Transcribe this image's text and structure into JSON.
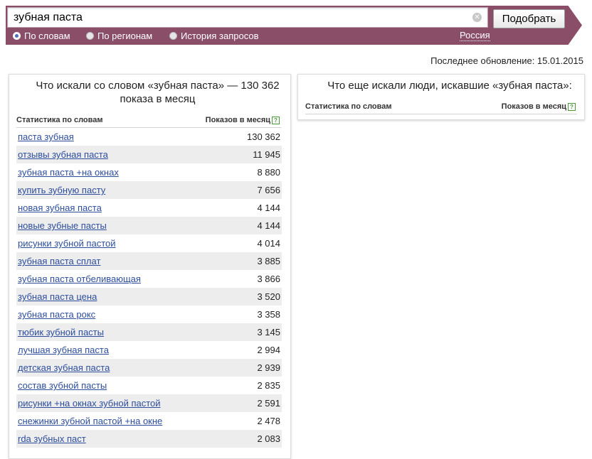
{
  "search": {
    "query": "зубная паста",
    "submit_label": "Подобрать"
  },
  "modes": [
    {
      "label": "По словам",
      "selected": true
    },
    {
      "label": "По регионам",
      "selected": false
    },
    {
      "label": "История запросов",
      "selected": false
    }
  ],
  "region": "Россия",
  "last_update": "Последнее обновление: 15.01.2015",
  "left_panel": {
    "title": "Что искали со словом «зубная паста» — 130 362 показа в месяц",
    "col_keyword": "Статистика по словам",
    "col_count": "Показов в месяц",
    "help": "?",
    "rows": [
      {
        "keyword": "паста зубная",
        "count": "130 362"
      },
      {
        "keyword": "отзывы зубная паста",
        "count": "11 945"
      },
      {
        "keyword": "зубная паста +на окнах",
        "count": "8 880"
      },
      {
        "keyword": "купить зубную пасту",
        "count": "7 656"
      },
      {
        "keyword": "новая зубная паста",
        "count": "4 144"
      },
      {
        "keyword": "новые зубные пасты",
        "count": "4 144"
      },
      {
        "keyword": "рисунки зубной пастой",
        "count": "4 014"
      },
      {
        "keyword": "зубная паста сплат",
        "count": "3 885"
      },
      {
        "keyword": "зубная паста отбеливающая",
        "count": "3 866"
      },
      {
        "keyword": "зубная паста цена",
        "count": "3 520"
      },
      {
        "keyword": "зубная паста рокс",
        "count": "3 358"
      },
      {
        "keyword": "тюбик зубной пасты",
        "count": "3 145"
      },
      {
        "keyword": "лучшая зубная паста",
        "count": "2 994"
      },
      {
        "keyword": "детская зубная паста",
        "count": "2 939"
      },
      {
        "keyword": "состав зубной пасты",
        "count": "2 835"
      },
      {
        "keyword": "рисунки +на окнах зубной пастой",
        "count": "2 591"
      },
      {
        "keyword": "снежинки зубной пастой +на окне",
        "count": "2 478"
      },
      {
        "keyword": "rda зубных паст",
        "count": "2 083"
      }
    ]
  },
  "right_panel": {
    "title": "Что еще искали люди, искавшие «зубная паста»:",
    "col_keyword": "Статистика по словам",
    "col_count": "Показов в месяц",
    "help": "?"
  },
  "colors": {
    "band": "#8a4e69",
    "link": "#2d4e9d",
    "row_alt": "#ededed"
  },
  "icons": [
    "clear-icon",
    "radio-icon",
    "help-icon"
  ]
}
